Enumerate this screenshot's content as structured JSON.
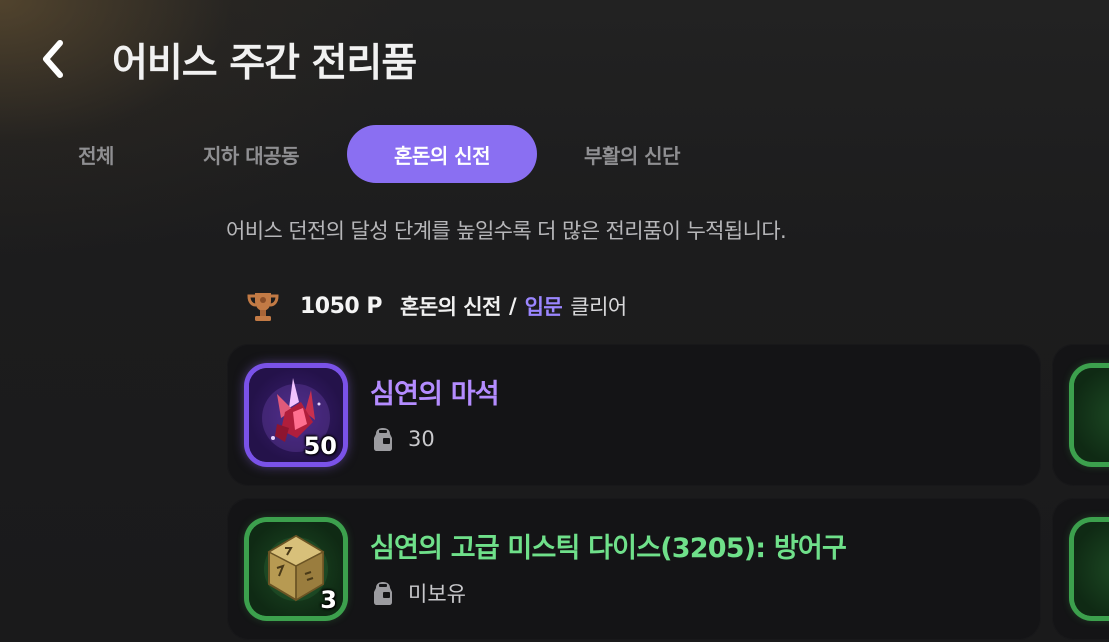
{
  "header": {
    "title": "어비스 주간 전리품"
  },
  "tabs": [
    {
      "label": "전체",
      "active": false
    },
    {
      "label": "지하 대공동",
      "active": false
    },
    {
      "label": "혼돈의 신전",
      "active": true
    },
    {
      "label": "부활의 신단",
      "active": false
    }
  ],
  "description": "어비스 던전의 달성 단계를 높일수록 더 많은 전리품이 누적됩니다.",
  "status": {
    "points": "1050 P",
    "dungeon": "혼돈의 신전",
    "separator": "/",
    "difficulty": "입문",
    "result": "클리어"
  },
  "items": [
    {
      "name": "심연의 마석",
      "quantity": "50",
      "owned": "30",
      "rarity_color": "#b48cff",
      "icon": "red-crystal-icon"
    },
    {
      "name": "심연의 고급 미스틱 다이스(3205): 방어구",
      "quantity": "3",
      "owned": "미보유",
      "rarity_color": "#6fe08a",
      "icon": "mystic-dice-icon"
    }
  ],
  "colors": {
    "accent": "#8a6ff2",
    "difficulty": "#9b86ff",
    "epic": "#7a52e8",
    "rare": "#3ca04d"
  }
}
